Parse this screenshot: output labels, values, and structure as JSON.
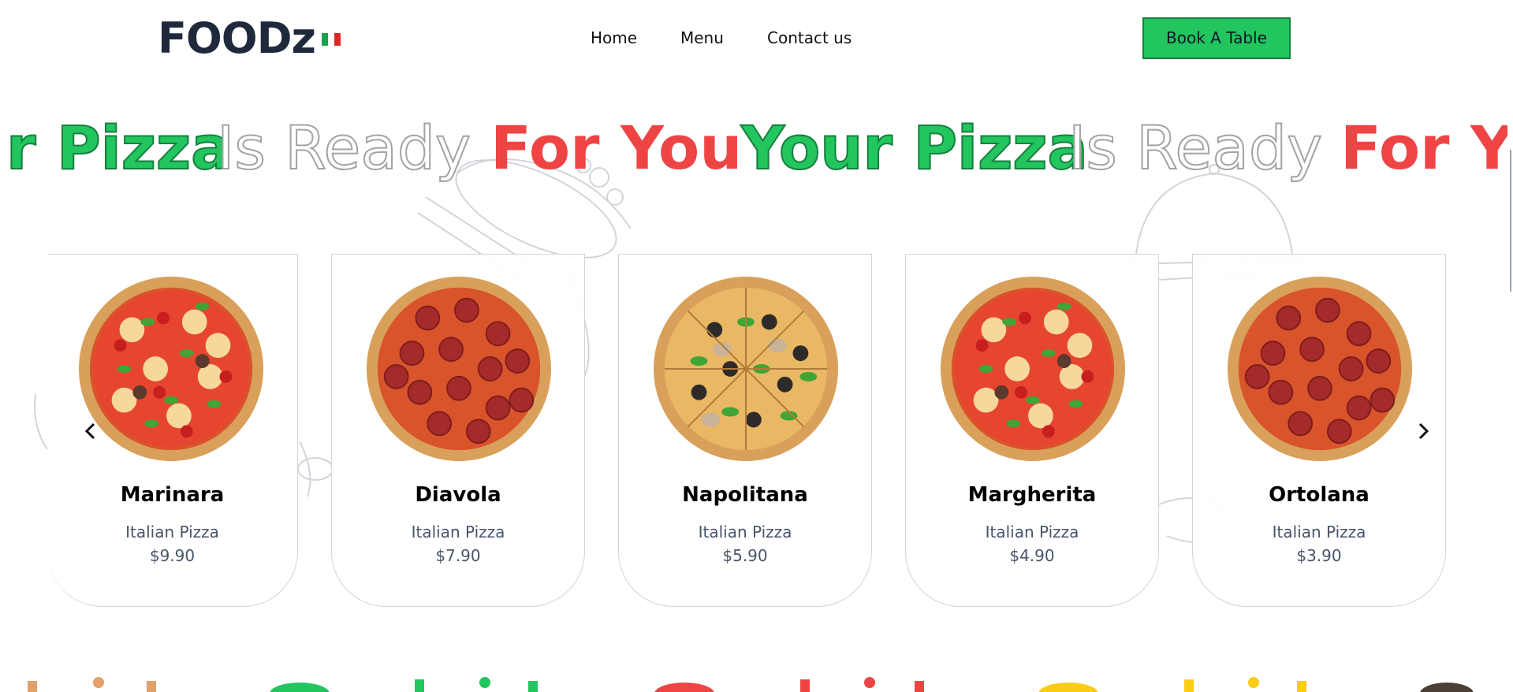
{
  "header": {
    "logo": "FOODz",
    "nav": [
      "Home",
      "Menu",
      "Contact us"
    ],
    "book_button": "Book A Table"
  },
  "marquee": {
    "words": [
      "r Pizza",
      "Is Ready",
      "For You",
      "Your Pizza",
      "Is Ready",
      "For Yo"
    ]
  },
  "carousel": {
    "prev_icon": "chevron-left-icon",
    "next_icon": "chevron-right-icon",
    "cards": [
      {
        "name": "Marinara",
        "type": "Italian Pizza",
        "price": "$9.90",
        "style": "margherita"
      },
      {
        "name": "Diavola",
        "type": "Italian Pizza",
        "price": "$7.90",
        "style": "pepperoni"
      },
      {
        "name": "Napolitana",
        "type": "Italian Pizza",
        "price": "$5.90",
        "style": "veggie"
      },
      {
        "name": "Margherita",
        "type": "Italian Pizza",
        "price": "$4.90",
        "style": "margherita"
      },
      {
        "name": "Ortolana",
        "type": "Italian Pizza",
        "price": "$3.90",
        "style": "pepperoni"
      }
    ]
  },
  "colors": {
    "brand_green": "#22c55e",
    "brand_red": "#ef4444",
    "text_dark": "#1e293b"
  }
}
